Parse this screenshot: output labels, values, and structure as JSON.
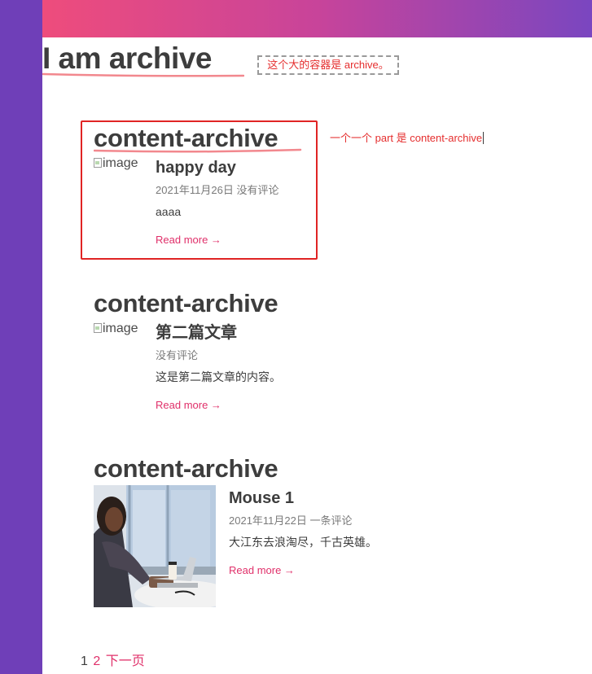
{
  "page": {
    "title": "I am archive",
    "annotation_container": "这个大的容器是 archive。",
    "annotation_part": "一个一个 part 是 content-archive"
  },
  "posts": [
    {
      "section_heading": "content-archive",
      "title": "happy day",
      "meta": "2021年11月26日 没有评论",
      "excerpt": "aaaa",
      "read_more": "Read more →",
      "image_alt": "image"
    },
    {
      "section_heading": "content-archive",
      "title": "第二篇文章",
      "meta": " 没有评论",
      "excerpt": "这是第二篇文章的内容。",
      "read_more": "Read more →",
      "image_alt": "image"
    },
    {
      "section_heading": "content-archive",
      "title": "Mouse 1",
      "meta": "2021年11月22日 一条评论",
      "excerpt": "大江东去浪淘尽，千古英雄。",
      "read_more": "Read more →"
    }
  ],
  "pagination": {
    "current": "1",
    "page2": "2",
    "next": "下一页"
  },
  "colors": {
    "accent": "#e0306a",
    "annotation": "#e52e2e",
    "sidebar": "#6f3fb8",
    "underline": "#f2888e"
  }
}
